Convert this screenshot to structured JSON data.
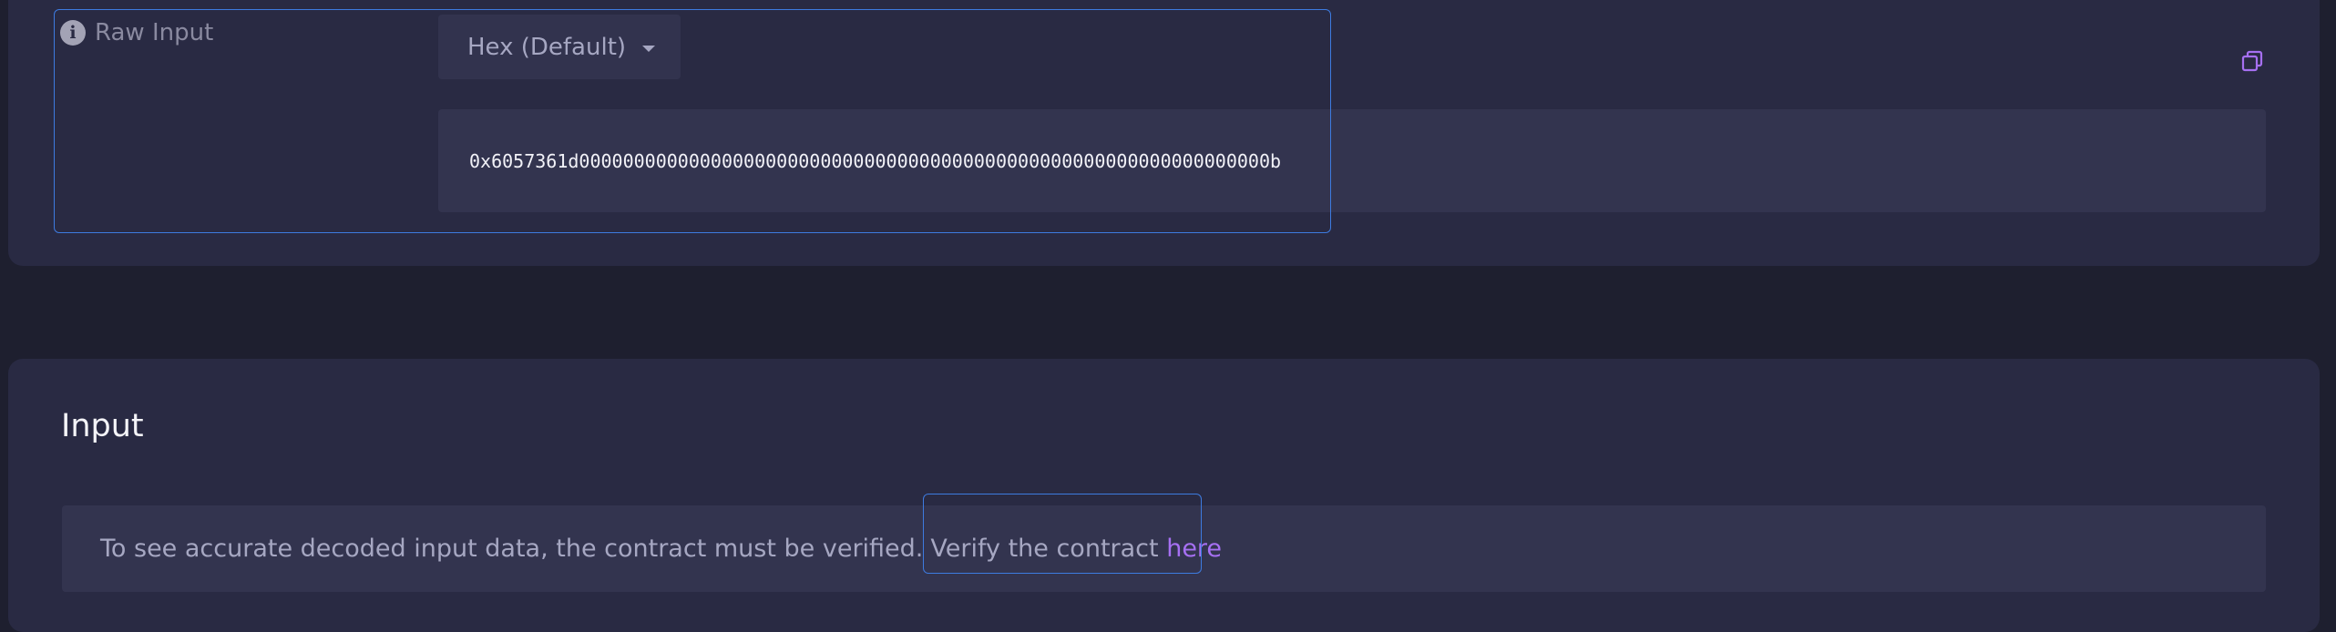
{
  "raw_input": {
    "label": "Raw Input",
    "info_icon": "info-icon",
    "format_dropdown": {
      "selected": "Hex (Default)"
    },
    "copy_icon": "copy-icon",
    "value": "0x6057361d000000000000000000000000000000000000000000000000000000000000000b"
  },
  "input_section": {
    "title": "Input",
    "notice": {
      "text": "To see accurate decoded input data, the contract must be verified.",
      "verify_prefix": "Verify the contract",
      "verify_link": "here"
    }
  },
  "colors": {
    "page_background": "#1e1f2f",
    "card_background": "#292a43",
    "field_background": "#33344f",
    "link": "#a670f2",
    "focus_outline": "#3d7be0"
  }
}
